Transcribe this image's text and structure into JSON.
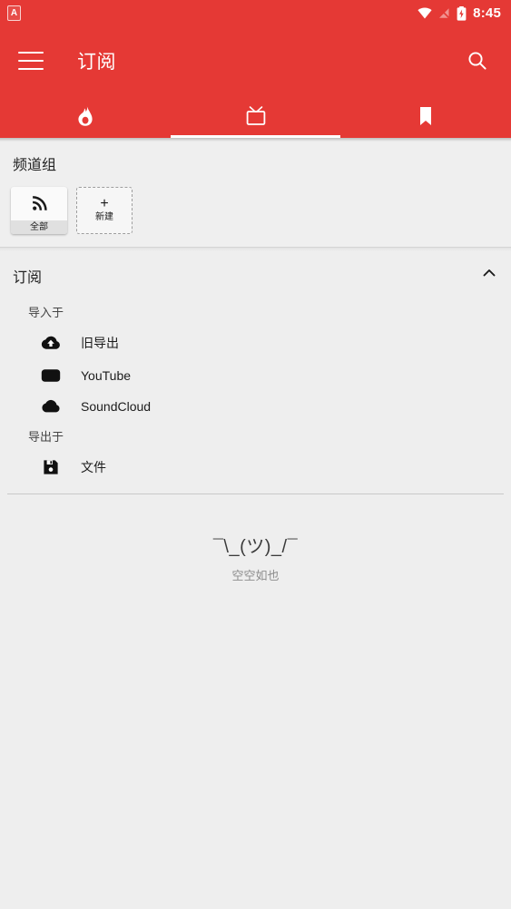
{
  "status_bar": {
    "notification_badge": "A",
    "wifi_icon": "wifi-icon",
    "signal_off_icon": "signal-off-icon",
    "battery_icon": "battery-charging-icon",
    "time": "8:45"
  },
  "app_bar": {
    "menu_icon": "hamburger-menu-icon",
    "title": "订阅",
    "search_icon": "search-icon"
  },
  "tabs": [
    {
      "name": "tab-trending",
      "icon": "whatshot-flame-icon",
      "active": false
    },
    {
      "name": "tab-subscriptions",
      "icon": "tv-icon",
      "active": true
    },
    {
      "name": "tab-bookmarks",
      "icon": "bookmark-icon",
      "active": false
    }
  ],
  "channel_groups": {
    "title": "频道组",
    "cards": [
      {
        "label": "全部",
        "icon": "rss-feed-icon",
        "type": "group"
      },
      {
        "label": "新建",
        "icon": "plus-icon",
        "type": "new"
      }
    ]
  },
  "subscriptions": {
    "title": "订阅",
    "collapse_icon": "chevron-up-icon",
    "import_label": "导入于",
    "import_items": [
      {
        "label": "旧导出",
        "icon": "cloud-upload-icon"
      },
      {
        "label": "YouTube",
        "icon": "youtube-icon"
      },
      {
        "label": "SoundCloud",
        "icon": "soundcloud-cloud-icon"
      }
    ],
    "export_label": "导出于",
    "export_items": [
      {
        "label": "文件",
        "icon": "save-file-icon"
      }
    ]
  },
  "empty_state": {
    "face": "¯\\_(ツ)_/¯",
    "text": "空空如也"
  },
  "colors": {
    "primary_red": "#e53935",
    "background": "#eeeeee",
    "text_primary": "#1c1c1c",
    "text_secondary": "#8c8c8c"
  }
}
